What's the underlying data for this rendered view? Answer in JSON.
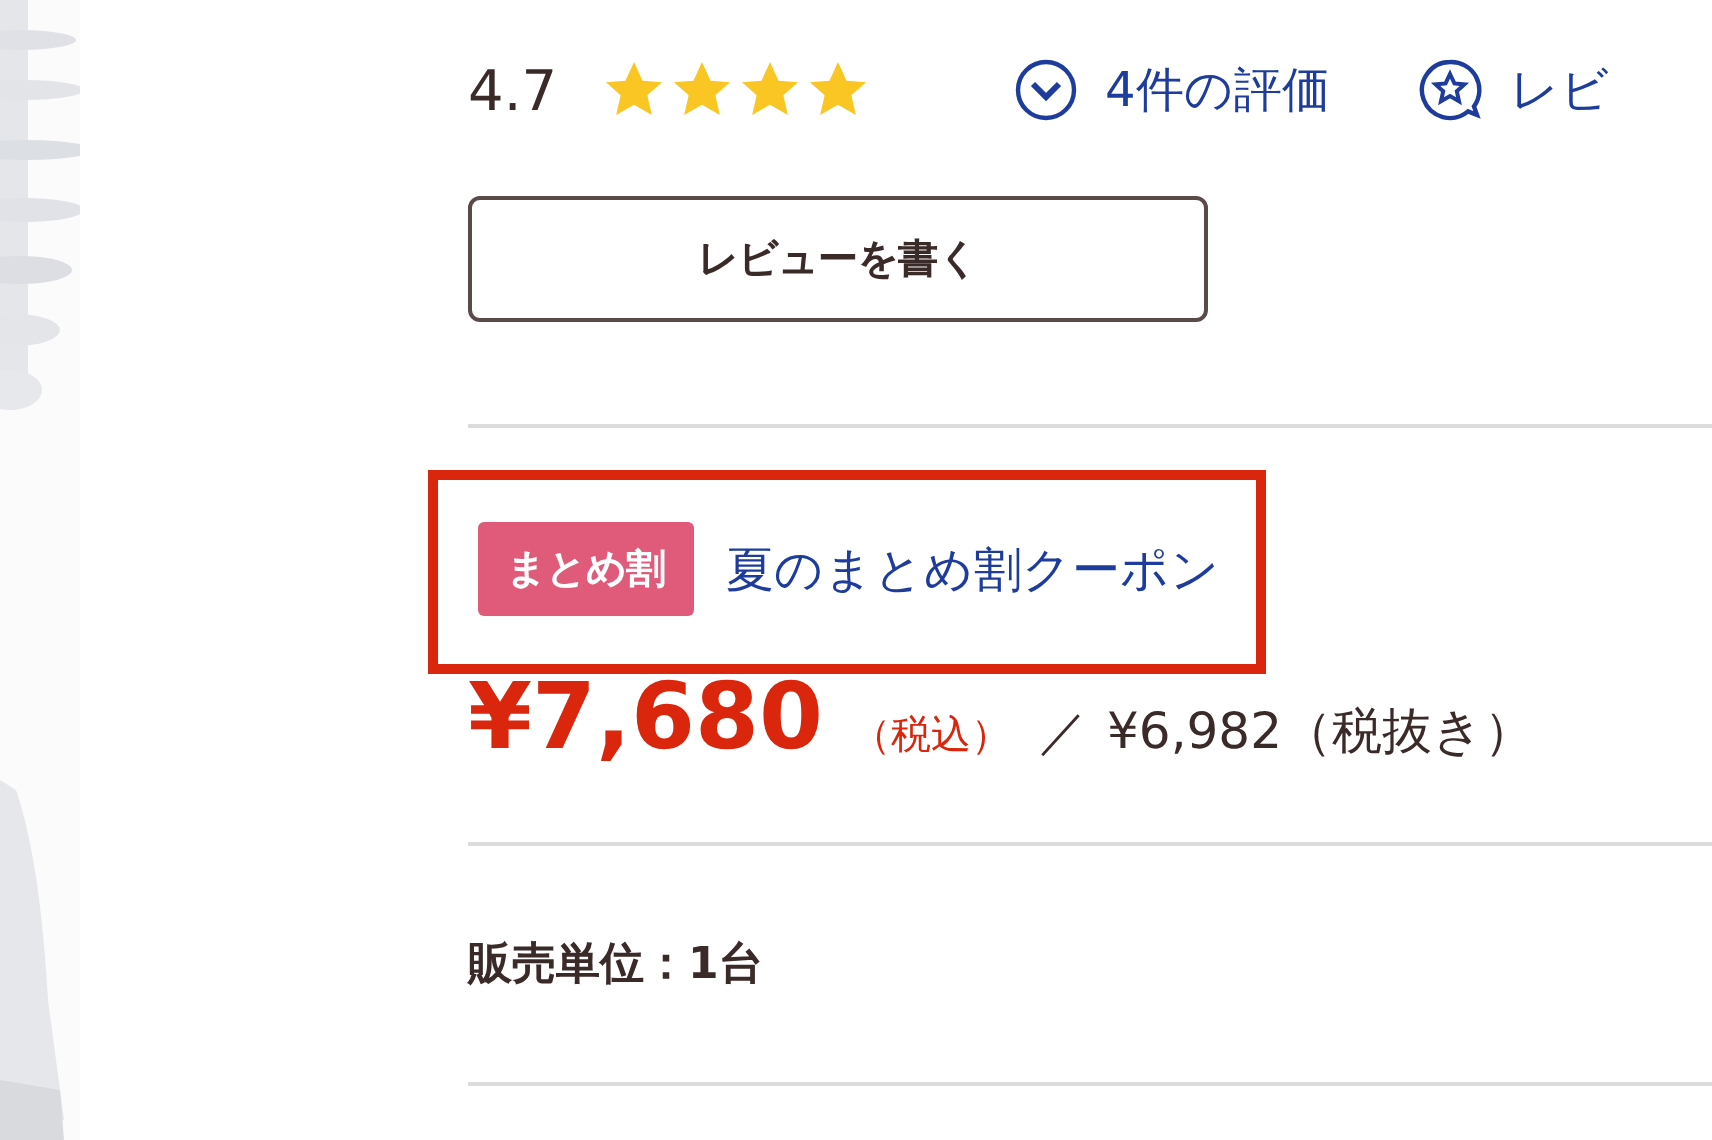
{
  "rating": {
    "score": "4.7",
    "stars": 4
  },
  "review_links": [
    {
      "label": "4件の評価"
    },
    {
      "label": "レビ"
    }
  ],
  "write_review_button": "レビューを書く",
  "coupon": {
    "highlighted": true,
    "badge": "まとめ割",
    "link": "夏のまとめ割クーポン"
  },
  "price": {
    "amount": "¥7,680",
    "tax_note": "（税込）",
    "separator": "／",
    "excl_tax": "¥6,982（税抜き）"
  },
  "sales_unit": "販売単位：1台"
}
